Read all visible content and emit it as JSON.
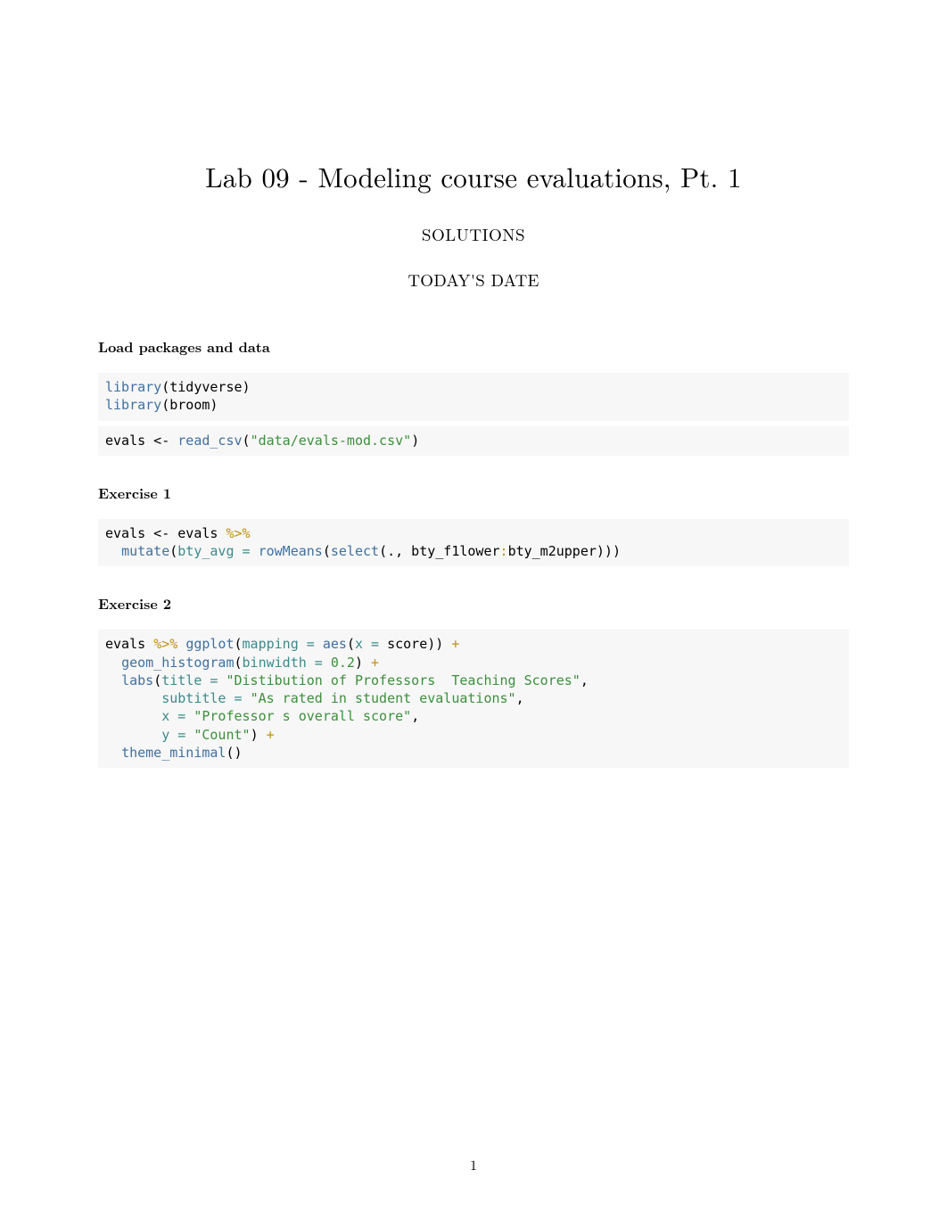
{
  "title": "Lab 09 - Modeling course evaluations, Pt. 1",
  "author": "SOLUTIONS",
  "date": "TODAY'S DATE",
  "sections": {
    "load": "Load packages and data",
    "ex1": "Exercise 1",
    "ex2": "Exercise 2"
  },
  "code": {
    "load_l1_fn": "library",
    "load_l1_arg": "(tidyverse)",
    "load_l2_fn": "library",
    "load_l2_arg": "(broom)",
    "load_b2_pre": "evals <- ",
    "load_b2_fn": "read_csv",
    "load_b2_open": "(",
    "load_b2_str": "\"data/evals-mod.csv\"",
    "load_b2_close": ")",
    "ex1_l1_pre": "evals <- evals ",
    "ex1_l1_pipe": "%>%",
    "ex1_l2_indent": "  ",
    "ex1_l2_mutate": "mutate",
    "ex1_l2_open": "(",
    "ex1_l2_arg": "bty_avg =",
    "ex1_l2_sp": " ",
    "ex1_l2_rowmeans": "rowMeans",
    "ex1_l2_open2": "(",
    "ex1_l2_select": "select",
    "ex1_l2_open3": "(., bty_f1lower",
    "ex1_l2_colon": ":",
    "ex1_l2_rest": "bty_m2upper)))",
    "ex2_l1_pre": "evals ",
    "ex2_l1_pipe": "%>%",
    "ex2_l1_sp": " ",
    "ex2_l1_ggplot": "ggplot",
    "ex2_l1_open": "(",
    "ex2_l1_arg": "mapping =",
    "ex2_l1_sp2": " ",
    "ex2_l1_aes": "aes",
    "ex2_l1_open2": "(",
    "ex2_l1_arg2": "x =",
    "ex2_l1_rest": " score)) ",
    "ex2_l1_plus": "+",
    "ex2_l2_indent": "  ",
    "ex2_l2_fn": "geom_histogram",
    "ex2_l2_open": "(",
    "ex2_l2_arg": "binwidth =",
    "ex2_l2_sp": " ",
    "ex2_l2_num": "0.2",
    "ex2_l2_close": ") ",
    "ex2_l2_plus": "+",
    "ex2_l3_indent": "  ",
    "ex2_l3_fn": "labs",
    "ex2_l3_open": "(",
    "ex2_l3_arg": "title =",
    "ex2_l3_sp": " ",
    "ex2_l3_str": "\"Distibution of Professors  Teaching Scores\"",
    "ex2_l3_close": ",",
    "ex2_l4_indent": "       ",
    "ex2_l4_arg": "subtitle =",
    "ex2_l4_sp": " ",
    "ex2_l4_str": "\"As rated in student evaluations\"",
    "ex2_l4_close": ",",
    "ex2_l5_indent": "       ",
    "ex2_l5_arg": "x =",
    "ex2_l5_sp": " ",
    "ex2_l5_str": "\"Professor s overall score\"",
    "ex2_l5_close": ",",
    "ex2_l6_indent": "       ",
    "ex2_l6_arg": "y =",
    "ex2_l6_sp": " ",
    "ex2_l6_str": "\"Count\"",
    "ex2_l6_close": ") ",
    "ex2_l6_plus": "+",
    "ex2_l7_indent": "  ",
    "ex2_l7_fn": "theme_minimal",
    "ex2_l7_rest": "()"
  },
  "page_number": "1"
}
